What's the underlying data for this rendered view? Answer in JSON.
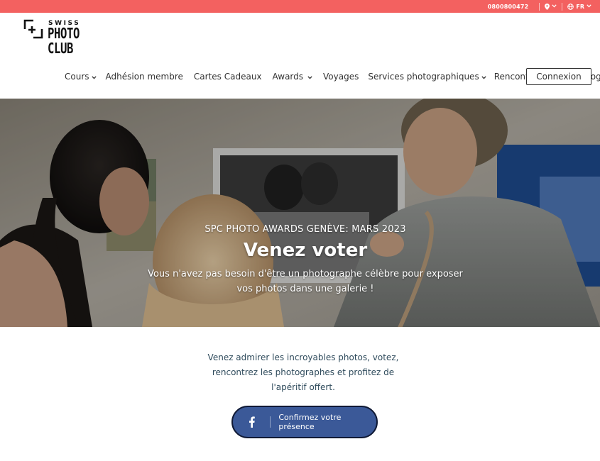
{
  "topbar": {
    "phone": "0800800472",
    "language": "FR"
  },
  "logo": {
    "line1": "SWISS",
    "line2": "PHOTO",
    "line3": "CLUB"
  },
  "nav": {
    "items": [
      {
        "label": "Cours",
        "has_dropdown": true
      },
      {
        "label": "Adhésion membre",
        "has_dropdown": false
      },
      {
        "label": "Cartes Cadeaux",
        "has_dropdown": false
      },
      {
        "label": "Awards",
        "has_dropdown": true
      },
      {
        "label": "Voyages",
        "has_dropdown": false
      },
      {
        "label": "Services photographiques",
        "has_dropdown": true
      },
      {
        "label": "Rencontrez-nous",
        "has_dropdown": true
      },
      {
        "label": "Blog",
        "has_dropdown": true
      }
    ],
    "login_label": "Connexion"
  },
  "hero": {
    "kicker": "SPC PHOTO AWARDS GENÈVE: MARS 2023",
    "title": "Venez voter",
    "subtitle": "Vous n'avez pas besoin d'être un photographe célèbre pour exposer vos photos dans une galerie !"
  },
  "content": {
    "intro": "Venez admirer les incroyables photos, votez, rencontrez les photographes et profitez de l'apéritif offert.",
    "cta_label": "Confirmez votre présence"
  },
  "colors": {
    "topbar": "#f36160",
    "facebook": "#3b5998",
    "text_dark_teal": "#2f4b5c"
  },
  "icons": {
    "location": "map-pin-icon",
    "language": "globe-icon",
    "dropdown": "chevron-down-icon",
    "facebook": "facebook-icon"
  }
}
